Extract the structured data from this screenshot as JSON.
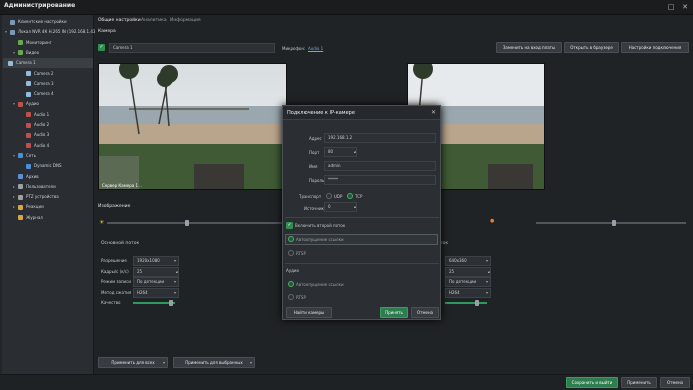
{
  "window": {
    "title": "Администрирование",
    "min": "□",
    "close": "✕"
  },
  "tree": [
    {
      "label": "Клиентские настройки",
      "icon": "gear-icon",
      "color": "#7a9bb5",
      "indent": 0,
      "arrow": ""
    },
    {
      "label": "Локал NVR 4К H.265 IN (192.168.1.43)",
      "icon": "server-icon",
      "color": "#7a9bb5",
      "indent": 0,
      "arrow": "▾"
    },
    {
      "label": "Мониторинг",
      "icon": "monitor-icon",
      "color": "#6aa84f",
      "indent": 1,
      "arrow": ""
    },
    {
      "label": "Видео",
      "icon": "video-icon",
      "color": "#6aa84f",
      "indent": 1,
      "arrow": "▾"
    },
    {
      "label": "Camera 1",
      "icon": "camera-icon",
      "color": "#8fbde0",
      "indent": 2,
      "arrow": "",
      "sel": true
    },
    {
      "label": "Camera 2",
      "icon": "camera-icon",
      "color": "#8fbde0",
      "indent": 2,
      "arrow": ""
    },
    {
      "label": "Camera 3",
      "icon": "camera-icon",
      "color": "#8fbde0",
      "indent": 2,
      "arrow": ""
    },
    {
      "label": "Camera 4",
      "icon": "camera-icon",
      "color": "#8fbde0",
      "indent": 2,
      "arrow": ""
    },
    {
      "label": "Аудио",
      "icon": "audio-icon",
      "color": "#c0504d",
      "indent": 1,
      "arrow": "▾"
    },
    {
      "label": "Audio 1",
      "icon": "mic-icon",
      "color": "#c0504d",
      "indent": 2,
      "arrow": ""
    },
    {
      "label": "Audio 2",
      "icon": "mic-icon",
      "color": "#c0504d",
      "indent": 2,
      "arrow": ""
    },
    {
      "label": "Audio 3",
      "icon": "mic-icon",
      "color": "#c0504d",
      "indent": 2,
      "arrow": ""
    },
    {
      "label": "Audio 4",
      "icon": "mic-icon",
      "color": "#c0504d",
      "indent": 2,
      "arrow": ""
    },
    {
      "label": "Сеть",
      "icon": "network-icon",
      "color": "#4a90d9",
      "indent": 1,
      "arrow": "▾"
    },
    {
      "label": "Dynamic DNS",
      "icon": "dns-icon",
      "color": "#4a90d9",
      "indent": 2,
      "arrow": ""
    },
    {
      "label": "Архив",
      "icon": "archive-icon",
      "color": "#5b8fd6",
      "indent": 1,
      "arrow": ""
    },
    {
      "label": "Пользователи",
      "icon": "users-icon",
      "color": "#9aa0a6",
      "indent": 1,
      "arrow": "▸"
    },
    {
      "label": "PTZ устройства",
      "icon": "ptz-icon",
      "color": "#9aa0a6",
      "indent": 1,
      "arrow": "▸"
    },
    {
      "label": "Реакции",
      "icon": "reaction-icon",
      "color": "#d9a441",
      "indent": 1,
      "arrow": "▸"
    },
    {
      "label": "Журнал",
      "icon": "journal-icon",
      "color": "#d9a441",
      "indent": 1,
      "arrow": ""
    }
  ],
  "tabs": [
    "Общие настройки",
    "Аналитика",
    "Информация"
  ],
  "camera_section": "Камера",
  "camera_name": "Camera 1",
  "microphone_label": "Микрофон:",
  "microphone_value": "Audio 1",
  "buttons": {
    "change_slot": "Заменить на вход платы",
    "open_browser": "Открыть в браузере",
    "conn_settings": "Настройки подключения"
  },
  "image_section": "Изображение",
  "main_stream": "Основной поток",
  "second_stream_tail": "ток",
  "left_fields": [
    {
      "label": "Разрешение",
      "value": "1920x1080"
    },
    {
      "label": "Кадры/с (к/с)",
      "value": "25"
    },
    {
      "label": "Режим записи",
      "value": "По детекции"
    },
    {
      "label": "Метод сжатия",
      "value": "H264"
    },
    {
      "label": "Качество",
      "value": ""
    }
  ],
  "right_fields": [
    "640x360",
    "25",
    "По детекции",
    "H264"
  ],
  "apply_all": "Применить для всех",
  "apply_selected": "Применить для выбранных",
  "bottom": {
    "save_exit": "Сохранить и выйти",
    "apply": "Применить",
    "cancel": "Отмена"
  },
  "modal": {
    "title": "Подключение к IP-камере",
    "close": "✕",
    "fields": [
      {
        "label": "Адрес",
        "value": "192.168.1.2"
      },
      {
        "label": "Порт",
        "value": "80"
      },
      {
        "label": "Имя",
        "value": "admin"
      },
      {
        "label": "Пароль",
        "value": "*****"
      }
    ],
    "transport_label": "Транспорт",
    "udp": "UDP",
    "tcp": "TCP",
    "source_label": "Источник",
    "source_value": "0",
    "second_stream": "Включить второй поток",
    "auto_links": "Автоопущение ссылки",
    "rtsp": "RTSP",
    "audio": "Аудио",
    "audio_auto": "Автоопущение ссылки",
    "audio_rtsp": "RTSP",
    "find": "Найти камеры",
    "apply": "Принять",
    "cancel": "Отмена"
  },
  "colors": {
    "accent": "#2e7d4e",
    "bg": "#232629"
  }
}
